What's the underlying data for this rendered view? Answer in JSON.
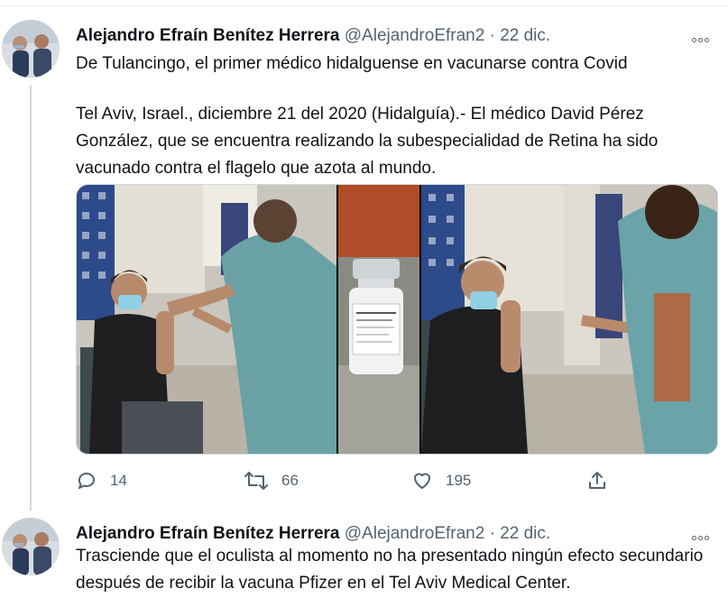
{
  "tweets": [
    {
      "display_name": "Alejandro Efraín Benítez Herrera",
      "handle": "@AlejandroEfran2",
      "separator": "·",
      "date": "22 dic.",
      "text_headline": "De Tulancingo, el primer médico hidalguense en vacunarse contra Covid",
      "text_body": "Tel Aviv, Israel., diciembre 21 del 2020 (Hidalguía).- El médico David Pérez González, que se encuentra realizando la subespecialidad de Retina ha sido vacunado contra el flagelo que azota al mundo.",
      "replies": "14",
      "retweets": "66",
      "likes": "195"
    },
    {
      "display_name": "Alejandro Efraín Benítez Herrera",
      "handle": "@AlejandroEfran2",
      "separator": "·",
      "date": "22 dic.",
      "text_body": "Trasciende que el oculista al momento no ha presentado ningún efecto secundario después de recibir la vacuna Pfizer en el Tel Aviv Medical Center."
    }
  ],
  "media": {
    "vial_label": "Pfizer-BioNTech COVID-19 Vaccine"
  },
  "icons": {
    "reply": "reply-icon",
    "retweet": "retweet-icon",
    "like": "like-icon",
    "share": "share-icon",
    "more": "more-icon"
  },
  "colors": {
    "text": "#0f1419",
    "secondary": "#536471",
    "border": "#cfd9de"
  }
}
